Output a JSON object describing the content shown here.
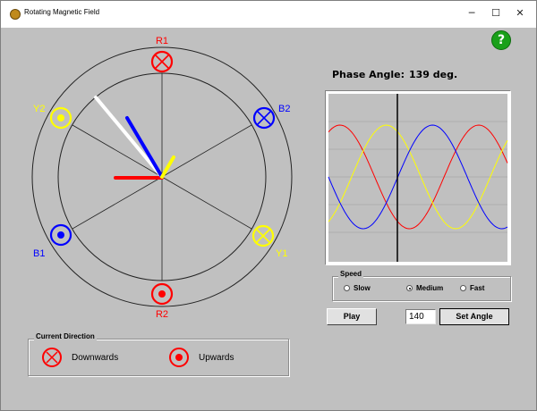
{
  "window": {
    "title": "Rotating Magnetic Field",
    "controls": {
      "minimize": "─",
      "maximize": "☐",
      "close": "✕"
    }
  },
  "help": {
    "label": "?",
    "icon": "help-icon"
  },
  "motor": {
    "coils": {
      "R1": {
        "label": "R1",
        "color": "#ff0000",
        "symbol": "cross"
      },
      "R2": {
        "label": "R2",
        "color": "#ff0000",
        "symbol": "dot"
      },
      "Y1": {
        "label": "Y1",
        "color": "#ffff00",
        "symbol": "cross"
      },
      "Y2": {
        "label": "Y2",
        "color": "#ffff00",
        "symbol": "dot"
      },
      "B1": {
        "label": "B1",
        "color": "#0000ff",
        "symbol": "dot"
      },
      "B2": {
        "label": "B2",
        "color": "#0000ff",
        "symbol": "cross"
      }
    },
    "phasors": {
      "resultant_color": "#ffffff",
      "red_color": "#ff0000",
      "yellow_color": "#ffff00",
      "blue_color": "#0000ff"
    }
  },
  "phase": {
    "label": "Phase Angle:",
    "value": "139 deg."
  },
  "waveform": {
    "series": [
      {
        "color": "#ff0000"
      },
      {
        "color": "#ffff00"
      },
      {
        "color": "#0000ff"
      }
    ]
  },
  "speed": {
    "title": "Speed",
    "options": [
      {
        "label": "Slow",
        "selected": false
      },
      {
        "label": "Medium",
        "selected": true
      },
      {
        "label": "Fast",
        "selected": false
      }
    ]
  },
  "controls": {
    "play_label": "Play",
    "angle_value": "140",
    "set_angle_label": "Set Angle"
  },
  "current_direction": {
    "title": "Current Direction",
    "downwards": "Downwards",
    "upwards": "Upwards"
  }
}
